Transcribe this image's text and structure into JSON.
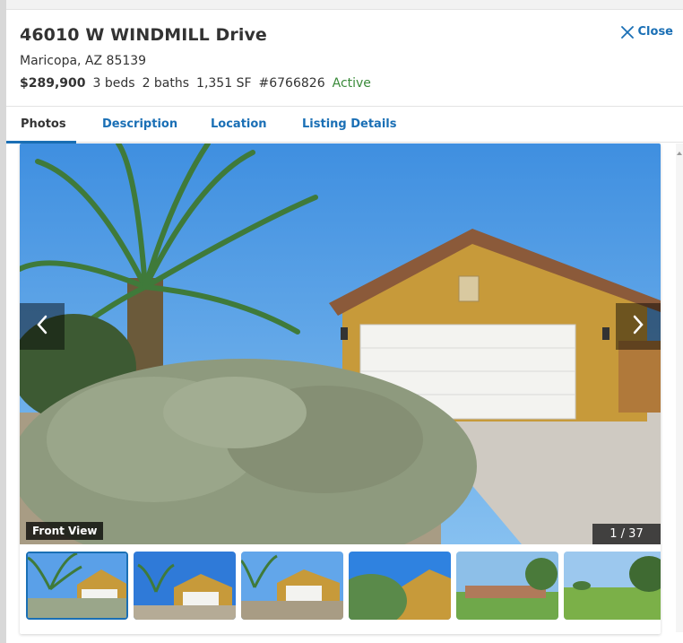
{
  "listing": {
    "address_line1": "46010 W WINDMILL Drive",
    "address_line2": "Maricopa, AZ 85139",
    "price": "$289,900",
    "beds": "3 beds",
    "baths": "2 baths",
    "area": "1,351 SF",
    "mls": "#6766826",
    "status": "Active"
  },
  "close_label": "Close",
  "tabs": [
    {
      "label": "Photos",
      "active": true
    },
    {
      "label": "Description",
      "active": false
    },
    {
      "label": "Location",
      "active": false
    },
    {
      "label": "Listing Details",
      "active": false
    }
  ],
  "gallery": {
    "caption": "Front View",
    "counter": "1 / 37",
    "prev_icon": "chevron-left-icon",
    "next_icon": "chevron-right-icon"
  },
  "colors": {
    "accent": "#1a6fb5",
    "status": "#3a8a3a",
    "text": "#333333"
  }
}
